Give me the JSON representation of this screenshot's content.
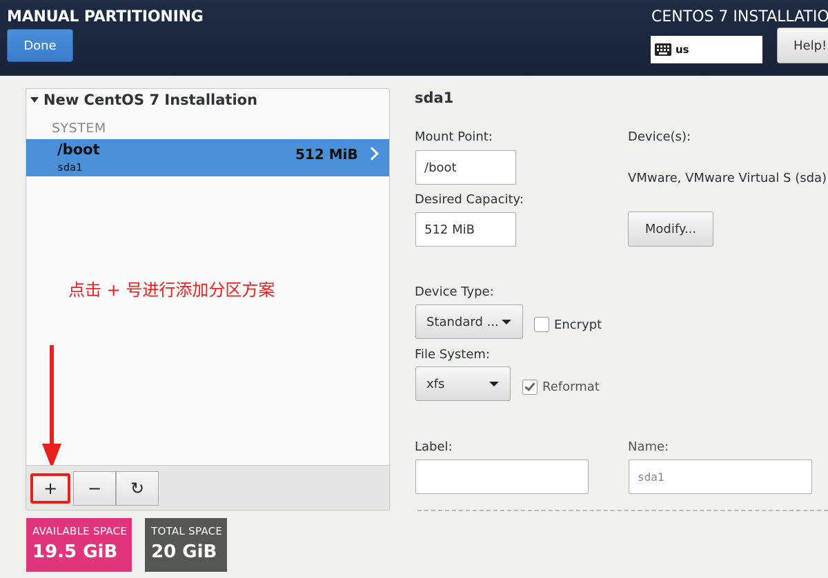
{
  "header": {
    "title": "MANUAL PARTITIONING",
    "done_label": "Done",
    "product_title": "CENTOS 7 INSTALLATIO",
    "keyboard_layout": "us",
    "help_label": "Help!"
  },
  "tree": {
    "installation_label": "New CentOS 7 Installation",
    "section_label": "SYSTEM",
    "partitions": [
      {
        "mount": "/boot",
        "device": "sda1",
        "size": "512 MiB",
        "selected": true
      }
    ],
    "toolbar": {
      "add": "+",
      "remove": "−",
      "refresh": "↻"
    }
  },
  "annotation": {
    "text": "点击 + 号进行添加分区方案",
    "color": "#e8201e"
  },
  "space": {
    "available_label": "AVAILABLE SPACE",
    "available_value": "19.5 GiB",
    "total_label": "TOTAL SPACE",
    "total_value": "20 GiB"
  },
  "detail": {
    "title": "sda1",
    "mount_point_label": "Mount Point:",
    "mount_point_value": "/boot",
    "desired_capacity_label": "Desired Capacity:",
    "desired_capacity_value": "512 MiB",
    "devices_label": "Device(s):",
    "devices_value": "VMware, VMware Virtual S (sda)",
    "modify_label": "Modify...",
    "device_type_label": "Device Type:",
    "device_type_value": "Standard ...",
    "encrypt_label": "Encrypt",
    "encrypt_checked": false,
    "file_system_label": "File System:",
    "file_system_value": "xfs",
    "reformat_label": "Reformat",
    "reformat_checked": true,
    "label_label": "Label:",
    "label_value": "",
    "name_label": "Name:",
    "name_value": "sda1"
  },
  "colors": {
    "header_bg": "#1f2c44",
    "accent_blue": "#4a90d9",
    "available_badge": "#e0357a",
    "total_badge": "#555753"
  }
}
